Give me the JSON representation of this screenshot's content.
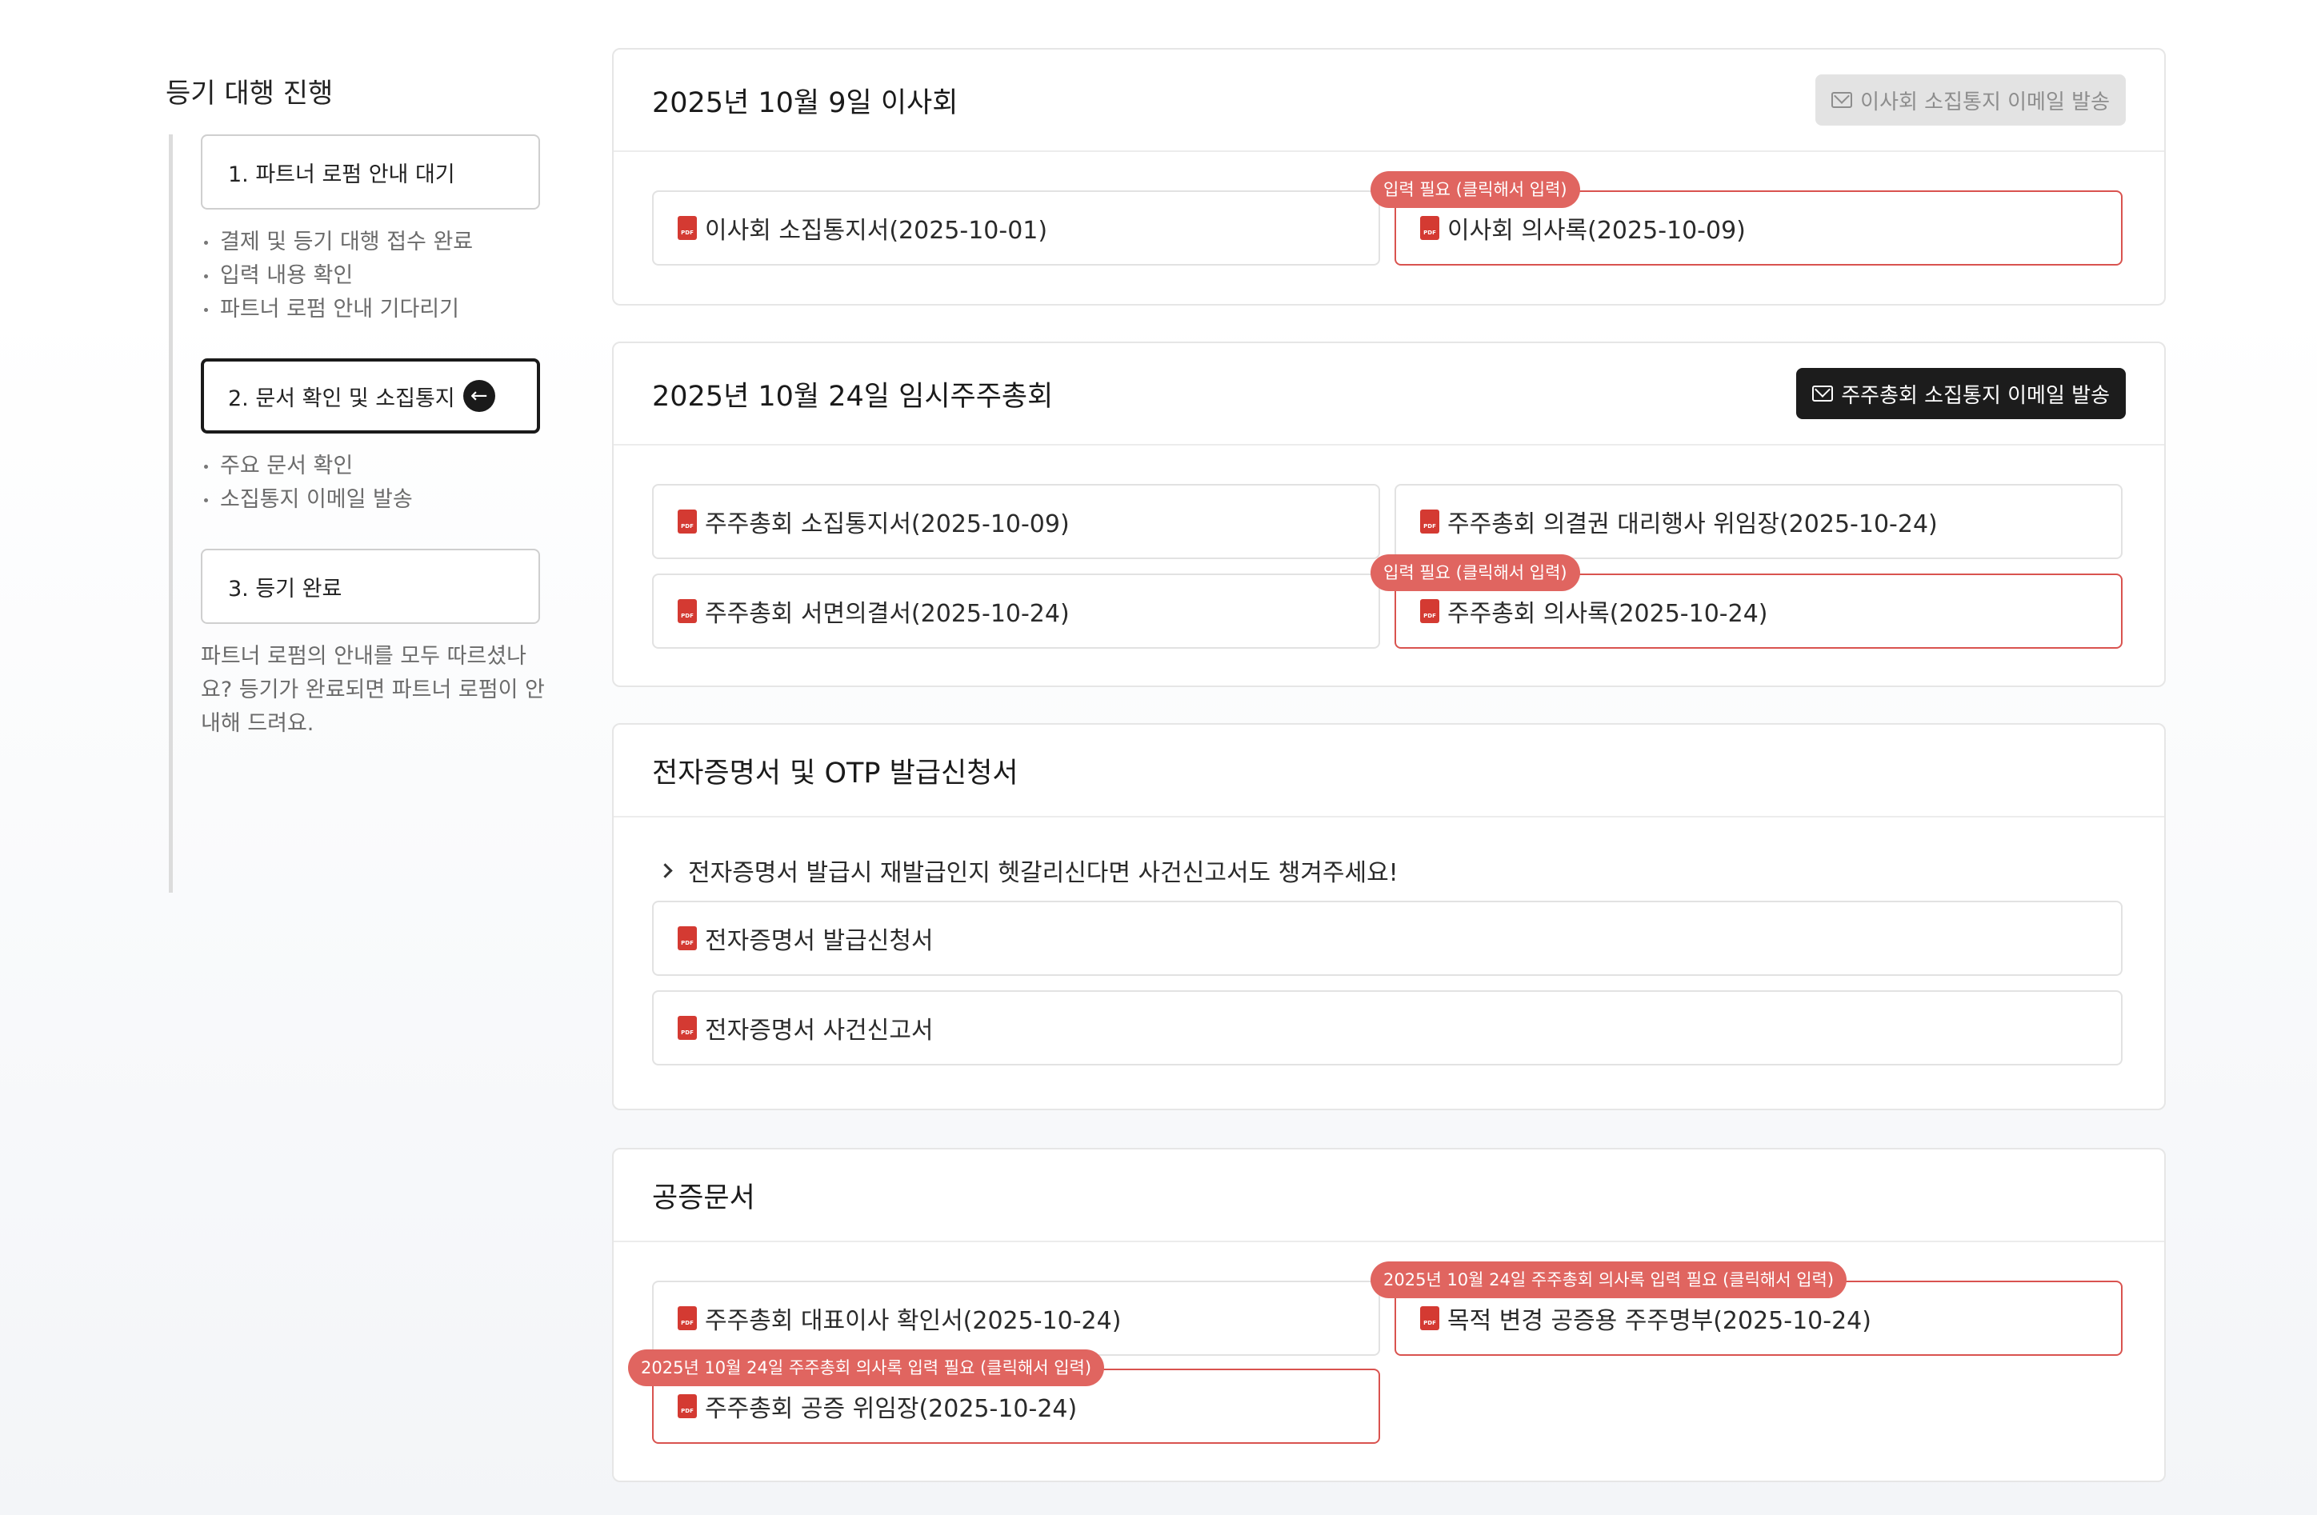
{
  "sidebar": {
    "title": "등기 대행 진행",
    "steps": [
      {
        "label": "1. 파트너 로펌 안내 대기",
        "items": [
          "결제 및 등기 대행 접수 완료",
          "입력 내용 확인",
          "파트너 로펌 안내 기다리기"
        ]
      },
      {
        "label": "2. 문서 확인 및 소집통지",
        "active": true,
        "items": [
          "주요 문서 확인",
          "소집통지 이메일 발송"
        ]
      },
      {
        "label": "3. 등기 완료",
        "note": "파트너 로펌의 안내를 모두 따르셨나요? 등기가 완료되면 파트너 로펌이 안내해 드려요."
      }
    ]
  },
  "cards": {
    "board": {
      "title": "2025년 10월 9일 이사회",
      "button": "이사회 소집통지 이메일 발송",
      "docs": [
        {
          "label": "이사회 소집통지서(2025-10-01)"
        },
        {
          "label": "이사회 의사록(2025-10-09)",
          "badge": "입력 필요 (클릭해서 입력)"
        }
      ]
    },
    "shareholders": {
      "title": "2025년 10월 24일 임시주주총회",
      "button": "주주총회 소집통지 이메일 발송",
      "docs": [
        {
          "label": "주주총회 소집통지서(2025-10-09)"
        },
        {
          "label": "주주총회 의결권 대리행사 위임장(2025-10-24)"
        },
        {
          "label": "주주총회 서면의결서(2025-10-24)"
        },
        {
          "label": "주주총회 의사록(2025-10-24)",
          "badge": "입력 필요 (클릭해서 입력)"
        }
      ]
    },
    "certificate": {
      "title": "전자증명서 및 OTP 발급신청서",
      "hint": "전자증명서 발급시 재발급인지 헷갈리신다면 사건신고서도 챙겨주세요!",
      "docs": [
        {
          "label": "전자증명서 발급신청서"
        },
        {
          "label": "전자증명서 사건신고서"
        }
      ]
    },
    "notary": {
      "title": "공증문서",
      "docs": [
        {
          "label": "주주총회 대표이사 확인서(2025-10-24)"
        },
        {
          "label": "목적 변경 공증용 주주명부(2025-10-24)",
          "badge": "2025년 10월 24일 주주총회 의사록 입력 필요 (클릭해서 입력)"
        },
        {
          "label": "주주총회 공증 위임장(2025-10-24)",
          "badge": "2025년 10월 24일 주주총회 의사록 입력 필요 (클릭해서 입력)"
        }
      ]
    }
  },
  "colors": {
    "accent": "#1c1c1c",
    "required_border": "#d9534f",
    "badge_bg": "#e06560",
    "pdf_icon": "#d43a32",
    "disabled_button_bg": "#e3e3e3"
  },
  "icons": {
    "document": "pdf-icon",
    "mail": "mail-icon",
    "active_step": "arrow-left-circle-icon",
    "hint": "chevron-right-icon"
  }
}
